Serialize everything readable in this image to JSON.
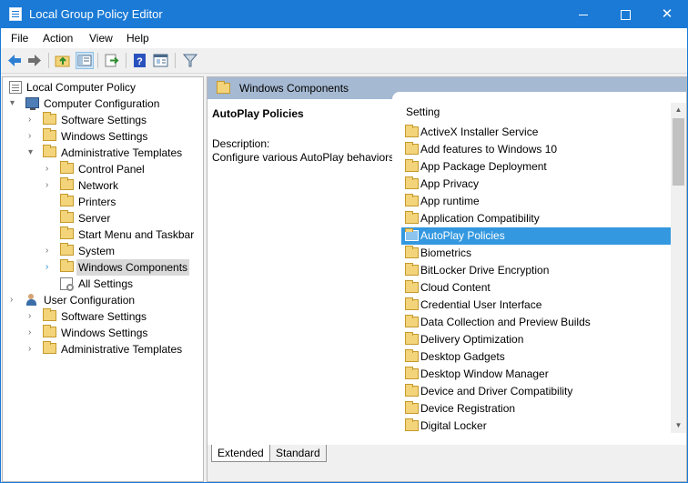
{
  "window": {
    "title": "Local Group Policy Editor"
  },
  "menu": [
    "File",
    "Action",
    "View",
    "Help"
  ],
  "toolbar": [
    "back-icon",
    "forward-icon",
    "up-folder-icon",
    "show-tree-icon",
    "export-icon",
    "help-icon",
    "properties-icon",
    "filter-icon"
  ],
  "tree": {
    "root": "Local Computer Policy",
    "computer_config": "Computer Configuration",
    "cc_software": "Software Settings",
    "cc_windows": "Windows Settings",
    "cc_admin": "Administrative Templates",
    "control_panel": "Control Panel",
    "network": "Network",
    "printers": "Printers",
    "server": "Server",
    "start_menu": "Start Menu and Taskbar",
    "system": "System",
    "windows_components": "Windows Components",
    "all_settings": "All Settings",
    "user_config": "User Configuration",
    "uc_software": "Software Settings",
    "uc_windows": "Windows Settings",
    "uc_admin": "Administrative Templates"
  },
  "right": {
    "header": "Windows Components",
    "desc_title": "AutoPlay Policies",
    "desc_label": "Description:",
    "desc_text": "Configure various AutoPlay behaviors.",
    "column_header": "Setting",
    "items": [
      "ActiveX Installer Service",
      "Add features to Windows 10",
      "App Package Deployment",
      "App Privacy",
      "App runtime",
      "Application Compatibility",
      "AutoPlay Policies",
      "Biometrics",
      "BitLocker Drive Encryption",
      "Cloud Content",
      "Credential User Interface",
      "Data Collection and Preview Builds",
      "Delivery Optimization",
      "Desktop Gadgets",
      "Desktop Window Manager",
      "Device and Driver Compatibility",
      "Device Registration",
      "Digital Locker"
    ],
    "selected_item": "AutoPlay Policies"
  },
  "tabs": {
    "extended": "Extended",
    "standard": "Standard"
  }
}
